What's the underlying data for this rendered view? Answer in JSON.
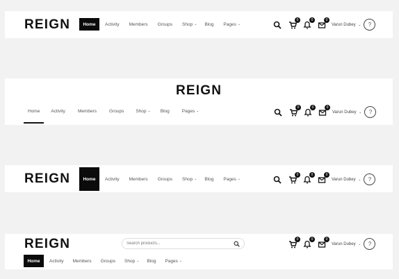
{
  "brand": {
    "logo_text": "REIGN"
  },
  "nav": {
    "items": [
      {
        "label": "Home",
        "active": true
      },
      {
        "label": "Activity"
      },
      {
        "label": "Members"
      },
      {
        "label": "Groups"
      },
      {
        "label": "Shop",
        "has_dropdown": true
      },
      {
        "label": "Blog"
      },
      {
        "label": "Pages",
        "has_dropdown": true
      }
    ],
    "caret": "⌄"
  },
  "badges": {
    "cart": "0",
    "notifications": "0",
    "messages": "0"
  },
  "user": {
    "name": "Varun Dubey",
    "avatar_glyph": "?"
  },
  "search": {
    "placeholder": "Search products..."
  },
  "colors": {
    "active_bg": "#0b0b0b",
    "page_bg": "#f2f2f2",
    "header_bg": "#ffffff"
  }
}
